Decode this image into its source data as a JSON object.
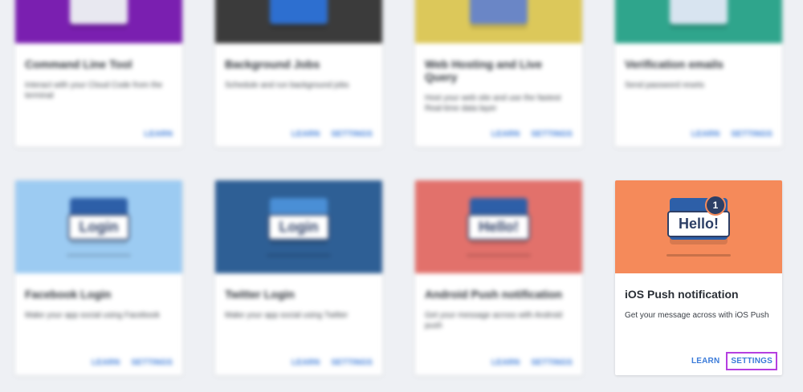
{
  "colors": {
    "page_bg": "#eef0f4",
    "link": "#3b7bd9",
    "highlight": "#b53fe0"
  },
  "top_row": [
    {
      "title": "Command Line Tool",
      "description": "Interact with your Cloud Code from the terminal",
      "learn": "LEARN",
      "settings": null,
      "hero_color": "#7a1fb0"
    },
    {
      "title": "Background Jobs",
      "description": "Schedule and run background jobs",
      "learn": "LEARN",
      "settings": "SETTINGS",
      "hero_color": "#3b3b3b"
    },
    {
      "title": "Web Hosting and Live Query",
      "description": "Host your web site and use the fastest Real-time data layer",
      "learn": "LEARN",
      "settings": "SETTINGS",
      "hero_color": "#dcc85a"
    },
    {
      "title": "Verification emails",
      "description": "Send password resets",
      "learn": "LEARN",
      "settings": "SETTINGS",
      "hero_color": "#2fa58c"
    }
  ],
  "bottom_row": [
    {
      "title": "Facebook Login",
      "description": "Make your app social using Facebook",
      "learn": "LEARN",
      "settings": "SETTINGS",
      "hero_color": "#9ccbf2",
      "bubble": "Login",
      "badge": ""
    },
    {
      "title": "Twitter Login",
      "description": "Make your app social using Twitter",
      "learn": "LEARN",
      "settings": "SETTINGS",
      "hero_color": "#2e5f95",
      "bubble": "Login",
      "badge": ""
    },
    {
      "title": "Android Push notification",
      "description": "Get your message across with Android push",
      "learn": "LEARN",
      "settings": "SETTINGS",
      "hero_color": "#e2716b",
      "bubble": "Hello!",
      "badge": ""
    },
    {
      "title": "iOS Push notification",
      "description": "Get your message across with iOS Push",
      "learn": "LEARN",
      "settings": "SETTINGS",
      "hero_color": "#f58a5a",
      "bubble": "Hello!",
      "badge": "1"
    }
  ]
}
